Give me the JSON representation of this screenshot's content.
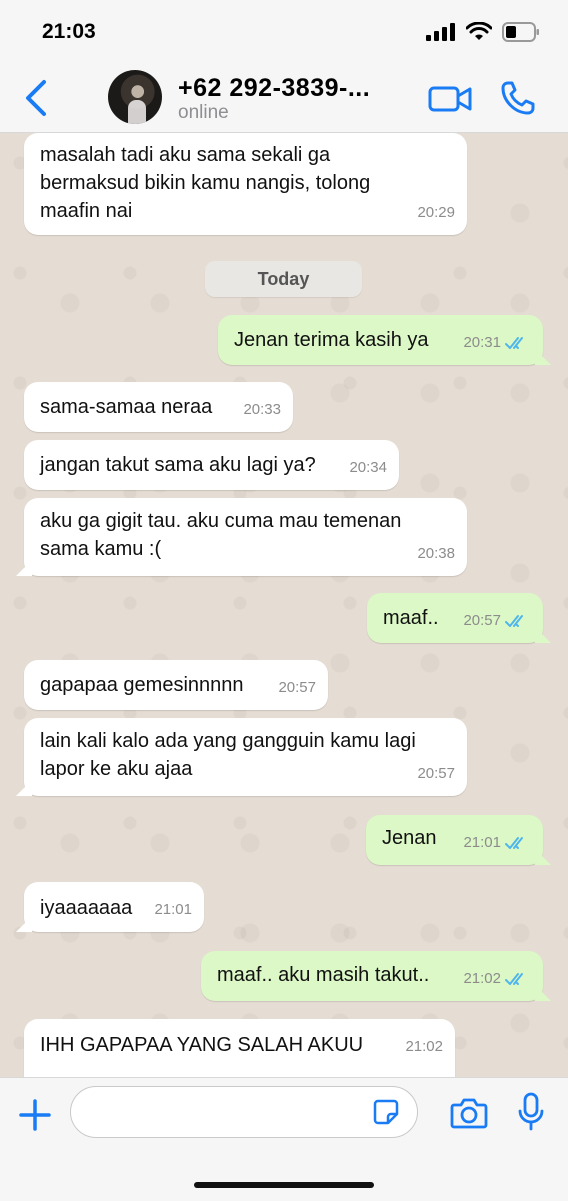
{
  "status_bar": {
    "time": "21:03"
  },
  "header": {
    "contact_name": "+62 292-3839-...",
    "status": "online"
  },
  "chat": {
    "date_divider": "Today",
    "messages": [
      {
        "dir": "in",
        "text": "masalah tadi aku sama sekali ga\nbermaksud bikin kamu nangis, tolong\nmaafin nai",
        "time": "20:29"
      },
      {
        "dir": "out",
        "text": "Jenan terima kasih ya",
        "time": "20:31"
      },
      {
        "dir": "in",
        "text": "sama-samaa neraa",
        "time": "20:33"
      },
      {
        "dir": "in",
        "text": "jangan takut sama aku lagi ya?",
        "time": "20:34"
      },
      {
        "dir": "in",
        "text": "aku ga gigit tau. aku cuma mau temenan\nsama kamu :(",
        "time": "20:38"
      },
      {
        "dir": "out",
        "text": "maaf..",
        "time": "20:57"
      },
      {
        "dir": "in",
        "text": "gapapaa gemesinnnnn",
        "time": "20:57"
      },
      {
        "dir": "in",
        "text": "lain kali kalo ada yang gangguin kamu lagi\nlapor ke aku ajaa",
        "time": "20:57"
      },
      {
        "dir": "out",
        "text": "Jenan",
        "time": "21:01"
      },
      {
        "dir": "in",
        "text": "iyaaaaaaa",
        "time": "21:01"
      },
      {
        "dir": "out",
        "text": "maaf.. aku masih takut..",
        "time": "21:02"
      },
      {
        "dir": "in",
        "text": "IHH GAPAPAA YANG SALAH AKUU",
        "time": "21:02"
      }
    ]
  },
  "input": {
    "placeholder": ""
  },
  "colors": {
    "accent": "#1a7cf4",
    "outgoing_bubble": "#dcf8c6",
    "incoming_bubble": "#ffffff",
    "read_ticks": "#4fb6ec"
  }
}
